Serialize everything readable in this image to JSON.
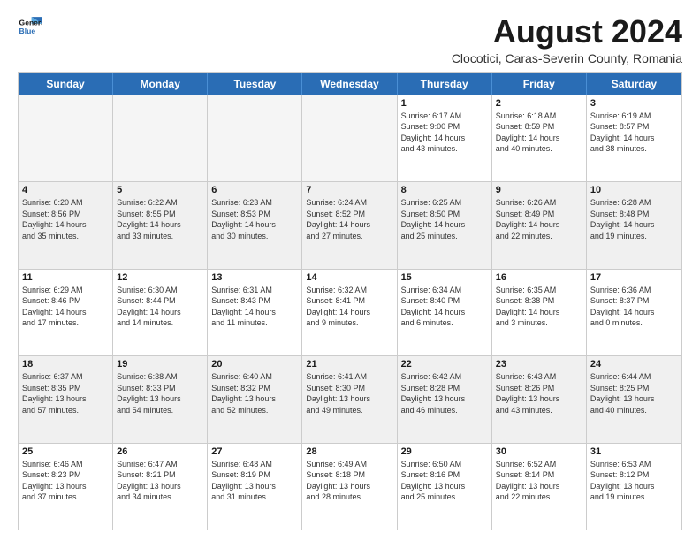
{
  "logo": {
    "line1": "General",
    "line2": "Blue"
  },
  "title": "August 2024",
  "subtitle": "Clocotici, Caras-Severin County, Romania",
  "days": [
    "Sunday",
    "Monday",
    "Tuesday",
    "Wednesday",
    "Thursday",
    "Friday",
    "Saturday"
  ],
  "rows": [
    [
      {
        "day": "",
        "info": "",
        "empty": true
      },
      {
        "day": "",
        "info": "",
        "empty": true
      },
      {
        "day": "",
        "info": "",
        "empty": true
      },
      {
        "day": "",
        "info": "",
        "empty": true
      },
      {
        "day": "1",
        "info": "Sunrise: 6:17 AM\nSunset: 9:00 PM\nDaylight: 14 hours\nand 43 minutes."
      },
      {
        "day": "2",
        "info": "Sunrise: 6:18 AM\nSunset: 8:59 PM\nDaylight: 14 hours\nand 40 minutes."
      },
      {
        "day": "3",
        "info": "Sunrise: 6:19 AM\nSunset: 8:57 PM\nDaylight: 14 hours\nand 38 minutes."
      }
    ],
    [
      {
        "day": "4",
        "info": "Sunrise: 6:20 AM\nSunset: 8:56 PM\nDaylight: 14 hours\nand 35 minutes."
      },
      {
        "day": "5",
        "info": "Sunrise: 6:22 AM\nSunset: 8:55 PM\nDaylight: 14 hours\nand 33 minutes."
      },
      {
        "day": "6",
        "info": "Sunrise: 6:23 AM\nSunset: 8:53 PM\nDaylight: 14 hours\nand 30 minutes."
      },
      {
        "day": "7",
        "info": "Sunrise: 6:24 AM\nSunset: 8:52 PM\nDaylight: 14 hours\nand 27 minutes."
      },
      {
        "day": "8",
        "info": "Sunrise: 6:25 AM\nSunset: 8:50 PM\nDaylight: 14 hours\nand 25 minutes."
      },
      {
        "day": "9",
        "info": "Sunrise: 6:26 AM\nSunset: 8:49 PM\nDaylight: 14 hours\nand 22 minutes."
      },
      {
        "day": "10",
        "info": "Sunrise: 6:28 AM\nSunset: 8:48 PM\nDaylight: 14 hours\nand 19 minutes."
      }
    ],
    [
      {
        "day": "11",
        "info": "Sunrise: 6:29 AM\nSunset: 8:46 PM\nDaylight: 14 hours\nand 17 minutes."
      },
      {
        "day": "12",
        "info": "Sunrise: 6:30 AM\nSunset: 8:44 PM\nDaylight: 14 hours\nand 14 minutes."
      },
      {
        "day": "13",
        "info": "Sunrise: 6:31 AM\nSunset: 8:43 PM\nDaylight: 14 hours\nand 11 minutes."
      },
      {
        "day": "14",
        "info": "Sunrise: 6:32 AM\nSunset: 8:41 PM\nDaylight: 14 hours\nand 9 minutes."
      },
      {
        "day": "15",
        "info": "Sunrise: 6:34 AM\nSunset: 8:40 PM\nDaylight: 14 hours\nand 6 minutes."
      },
      {
        "day": "16",
        "info": "Sunrise: 6:35 AM\nSunset: 8:38 PM\nDaylight: 14 hours\nand 3 minutes."
      },
      {
        "day": "17",
        "info": "Sunrise: 6:36 AM\nSunset: 8:37 PM\nDaylight: 14 hours\nand 0 minutes."
      }
    ],
    [
      {
        "day": "18",
        "info": "Sunrise: 6:37 AM\nSunset: 8:35 PM\nDaylight: 13 hours\nand 57 minutes."
      },
      {
        "day": "19",
        "info": "Sunrise: 6:38 AM\nSunset: 8:33 PM\nDaylight: 13 hours\nand 54 minutes."
      },
      {
        "day": "20",
        "info": "Sunrise: 6:40 AM\nSunset: 8:32 PM\nDaylight: 13 hours\nand 52 minutes."
      },
      {
        "day": "21",
        "info": "Sunrise: 6:41 AM\nSunset: 8:30 PM\nDaylight: 13 hours\nand 49 minutes."
      },
      {
        "day": "22",
        "info": "Sunrise: 6:42 AM\nSunset: 8:28 PM\nDaylight: 13 hours\nand 46 minutes."
      },
      {
        "day": "23",
        "info": "Sunrise: 6:43 AM\nSunset: 8:26 PM\nDaylight: 13 hours\nand 43 minutes."
      },
      {
        "day": "24",
        "info": "Sunrise: 6:44 AM\nSunset: 8:25 PM\nDaylight: 13 hours\nand 40 minutes."
      }
    ],
    [
      {
        "day": "25",
        "info": "Sunrise: 6:46 AM\nSunset: 8:23 PM\nDaylight: 13 hours\nand 37 minutes."
      },
      {
        "day": "26",
        "info": "Sunrise: 6:47 AM\nSunset: 8:21 PM\nDaylight: 13 hours\nand 34 minutes."
      },
      {
        "day": "27",
        "info": "Sunrise: 6:48 AM\nSunset: 8:19 PM\nDaylight: 13 hours\nand 31 minutes."
      },
      {
        "day": "28",
        "info": "Sunrise: 6:49 AM\nSunset: 8:18 PM\nDaylight: 13 hours\nand 28 minutes."
      },
      {
        "day": "29",
        "info": "Sunrise: 6:50 AM\nSunset: 8:16 PM\nDaylight: 13 hours\nand 25 minutes."
      },
      {
        "day": "30",
        "info": "Sunrise: 6:52 AM\nSunset: 8:14 PM\nDaylight: 13 hours\nand 22 minutes."
      },
      {
        "day": "31",
        "info": "Sunrise: 6:53 AM\nSunset: 8:12 PM\nDaylight: 13 hours\nand 19 minutes."
      }
    ]
  ]
}
